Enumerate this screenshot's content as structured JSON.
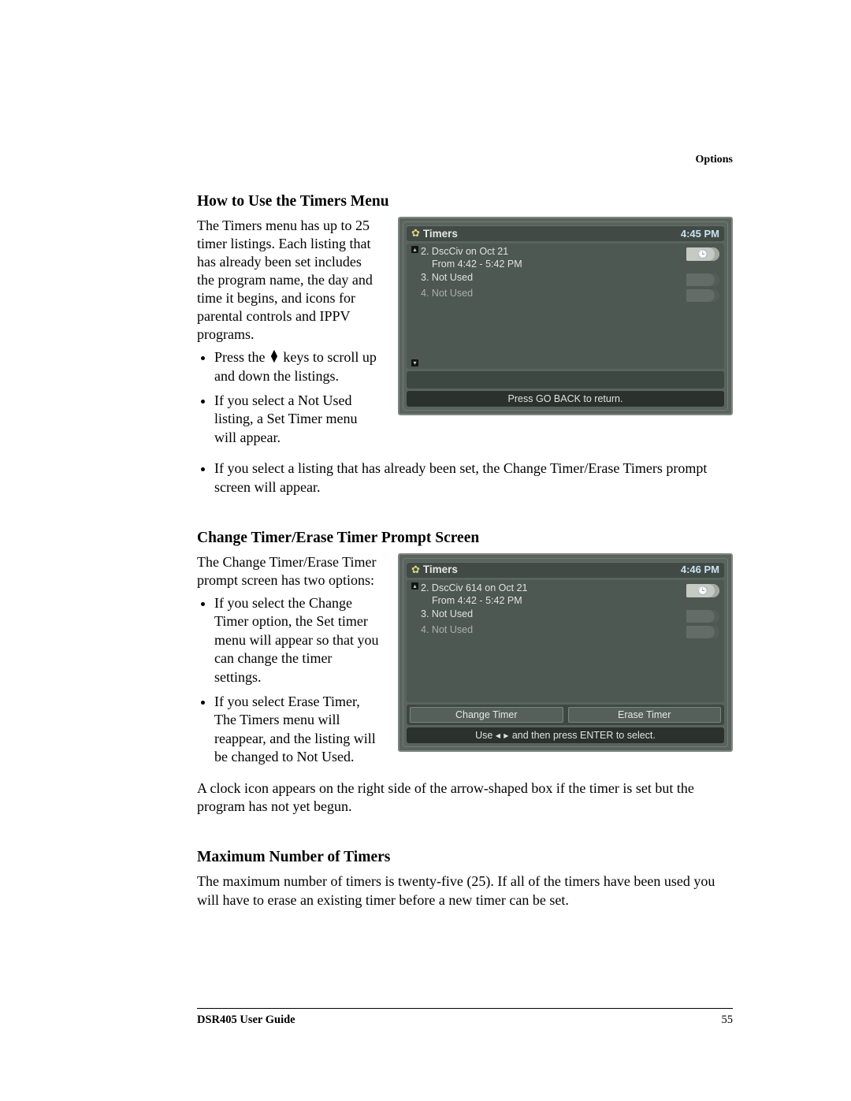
{
  "header": {
    "category": "Options"
  },
  "section1": {
    "title": "How to Use the Timers Menu",
    "intro": "The Timers menu has up to 25 timer listings. Each listing that has already been set includes the program name, the day and time it begins, and icons for parental controls and IPPV programs.",
    "bullets": [
      {
        "pre": "Press the ",
        "post": " keys to scroll up and down the listings."
      },
      {
        "text": "If you select a Not Used listing, a Set Timer menu will appear."
      }
    ],
    "after_bullets": [
      "If you select a listing that has already been set, the Change Timer/Erase Timers prompt screen will appear."
    ],
    "ui": {
      "title": "Timers",
      "clock": "4:45 PM",
      "rows": [
        {
          "n": "2.",
          "l1": "DscCiv on Oct 21",
          "l2": "From 4:42 - 5:42 PM",
          "icon": "clock"
        },
        {
          "n": "3.",
          "l1": "Not Used",
          "icon": "none"
        },
        {
          "n": "4.",
          "l1": "Not Used",
          "icon": "none",
          "dim": true
        }
      ],
      "help": "Press GO BACK to return."
    }
  },
  "section2": {
    "title": "Change Timer/Erase Timer Prompt Screen",
    "intro": "The Change Timer/Erase Timer prompt screen has two options:",
    "bullets": [
      "If you select the Change Timer option, the Set timer menu will appear so that you can change the timer settings.",
      "If you select Erase Timer, The Timers menu will reappear, and the listing will be changed to Not Used."
    ],
    "after": "A clock icon appears on the right side of the arrow-shaped box if the timer is set but the program has not yet begun.",
    "ui": {
      "title": "Timers",
      "clock": "4:46 PM",
      "rows": [
        {
          "n": "2.",
          "l1": "DscCiv 614 on Oct 21",
          "l2": "From 4:42 - 5:42 PM",
          "icon": "clock"
        },
        {
          "n": "3.",
          "l1": "Not Used",
          "icon": "none"
        },
        {
          "n": "4.",
          "l1": "Not Used",
          "icon": "none",
          "dim": true
        }
      ],
      "buttons": [
        "Change Timer",
        "Erase Timer"
      ],
      "help_pre": "Use ",
      "help_post": " and then press ENTER to select."
    }
  },
  "section3": {
    "title": "Maximum Number of Timers",
    "text": "The maximum number of timers is twenty-five (25). If all of the timers have been used you will have to erase an existing timer before a new timer can be set."
  },
  "footer": {
    "guide": "DSR405 User Guide",
    "page": "55"
  }
}
